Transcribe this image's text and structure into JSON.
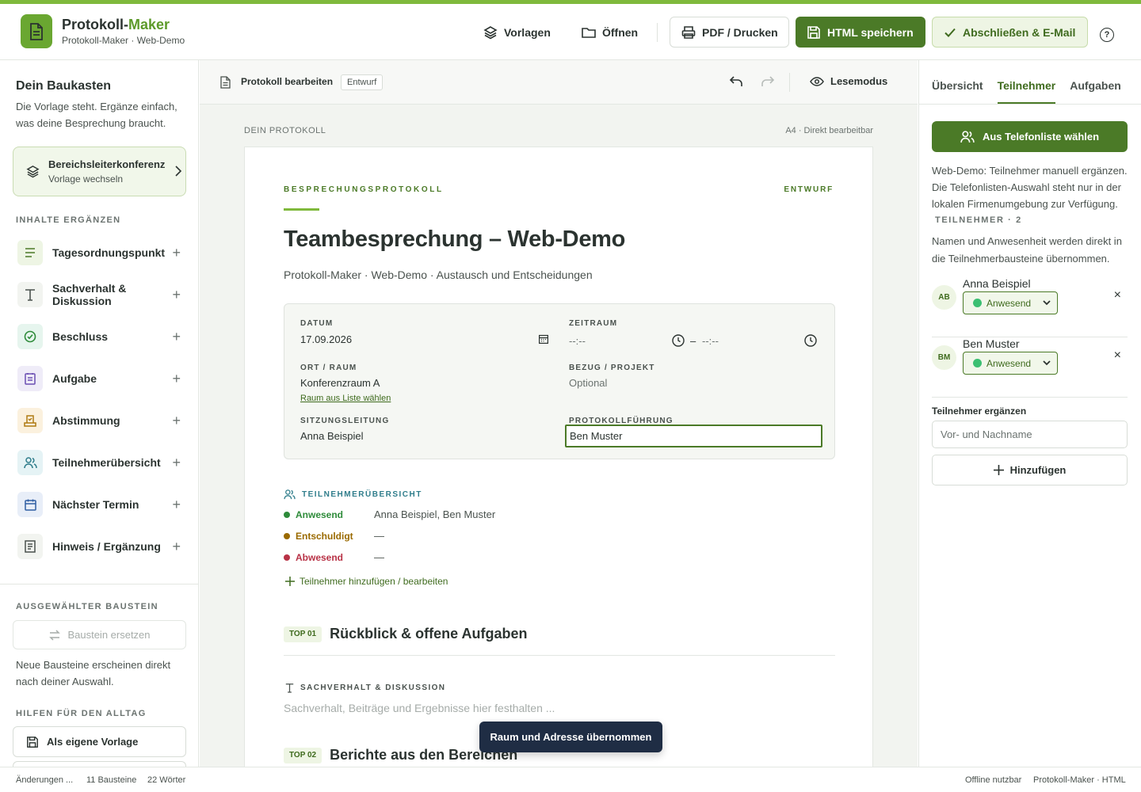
{
  "app": {
    "title_main": "Protokoll-",
    "title_accent": "Maker",
    "subtitle": "Protokoll-Maker · Web-Demo"
  },
  "header": {
    "templates": "Vorlagen",
    "open": "Öffnen",
    "print": "PDF / Drucken",
    "save_html": "HTML speichern",
    "finish": "Abschließen & E-Mail",
    "help": "?"
  },
  "sidebar": {
    "title": "Dein Baukasten",
    "description": "Die Vorlage steht. Ergänze einfach, was deine Besprechung braucht.",
    "template": {
      "name": "Bereichsleiterkonferenz",
      "action": "Vorlage wechseln"
    },
    "section_add": "INHALTE ERGÄNZEN",
    "items": [
      {
        "label": "Tagesordnungspunkt",
        "icon": "list-icon"
      },
      {
        "label": "Sachverhalt & Diskussion",
        "icon": "text-icon"
      },
      {
        "label": "Beschluss",
        "icon": "check-circle-icon"
      },
      {
        "label": "Aufgabe",
        "icon": "task-icon"
      },
      {
        "label": "Abstimmung",
        "icon": "vote-icon"
      },
      {
        "label": "Teilnehmerübersicht",
        "icon": "users-icon"
      },
      {
        "label": "Nächster Termin",
        "icon": "calendar-icon"
      },
      {
        "label": "Hinweis / Ergänzung",
        "icon": "note-icon"
      }
    ],
    "plus": "+",
    "section_selected": "AUSGEWÄHLTER BAUSTEIN",
    "replace": "Baustein ersetzen",
    "note": "Neue Bausteine erscheinen direkt nach deiner Auswahl.",
    "section_help": "HILFEN FÜR DEN ALLTAG",
    "save_template": "Als eigene Vorlage"
  },
  "editor": {
    "title": "Protokoll bearbeiten",
    "badge": "Entwurf",
    "read_mode": "Lesemodus",
    "doc_label": "DEIN PROTOKOLL",
    "doc_meta": "A4 · Direkt bearbeitbar"
  },
  "doc": {
    "kicker": "BESPRECHUNGSPROTOKOLL",
    "status": "ENTWURF",
    "title": "Teambesprechung – Web-Demo",
    "subtitle": "Protokoll-Maker · Web-Demo · Austausch und Entscheidungen",
    "meta": {
      "date_label": "DATUM",
      "date": "17.09.2026",
      "time_label": "ZEITRAUM",
      "time_from": "--:--",
      "time_sep": "–",
      "time_to": "--:--",
      "place_label": "ORT / RAUM",
      "place": "Konferenzraum A",
      "place_link": "Raum aus Liste wählen",
      "ref_label": "BEZUG / PROJEKT",
      "ref": "Optional",
      "lead_label": "SITZUNGSLEITUNG",
      "lead": "Anna Beispiel",
      "minutes_label": "PROTOKOLLFÜHRUNG",
      "minutes": "Ben Muster"
    },
    "participants": {
      "heading": "TEILNEHMERÜBERSICHT",
      "rows": [
        {
          "label": "Anwesend",
          "value": "Anna Beispiel, Ben Muster",
          "color": "#2e8b3a"
        },
        {
          "label": "Entschuldigt",
          "value": "—",
          "color": "#9a6a00"
        },
        {
          "label": "Abwesend",
          "value": "—",
          "color": "#b83246"
        }
      ],
      "edit_link": "Teilnehmer hinzufügen / bearbeiten"
    },
    "tops": [
      {
        "badge": "TOP 01",
        "title": "Rückblick & offene Aufgaben"
      },
      {
        "badge": "TOP 02",
        "title": "Berichte aus den Bereichen"
      }
    ],
    "discussion": {
      "heading": "SACHVERHALT & DISKUSSION",
      "placeholder": "Sachverhalt, Beiträge und Ergebnisse hier festhalten ..."
    }
  },
  "toast": "Raum und Adresse übernommen",
  "rpanel": {
    "tabs": [
      "Übersicht",
      "Teilnehmer",
      "Aufgaben"
    ],
    "active_tab": "Teilnehmer",
    "phone_list_btn": "Aus Telefonliste wählen",
    "note": "Web-Demo: Teilnehmer manuell ergänzen. Die Telefonlisten-Auswahl steht nur in der lokalen Firmenumgebung zur Verfügung.",
    "count": "TEILNEHMER · 2",
    "note2": "Namen und Anwesenheit werden direkt in die Teilnehmerbausteine übernommen.",
    "people": [
      {
        "initials": "AB",
        "name": "Anna Beispiel",
        "status": "Anwesend"
      },
      {
        "initials": "BM",
        "name": "Ben Muster",
        "status": "Anwesend"
      }
    ],
    "remove": "×",
    "add_label": "Teilnehmer ergänzen",
    "add_placeholder": "Vor- und Nachname",
    "add_btn": "Hinzufügen"
  },
  "footer": {
    "changes": "Änderungen ...",
    "blocks": "11 Bausteine",
    "words": "22 Wörter",
    "offline": "Offline nutzbar",
    "brand": "Protokoll-Maker · HTML"
  },
  "colors": {
    "accent": "#7fb93c",
    "primary": "#4b7a27",
    "toast": "#1f2d44"
  }
}
